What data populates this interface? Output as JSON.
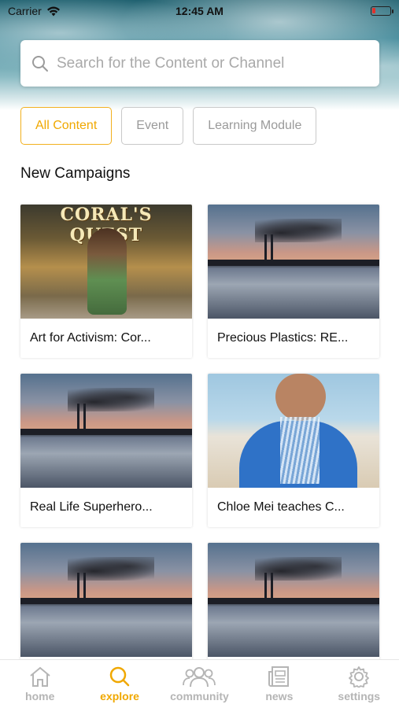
{
  "status_bar": {
    "carrier": "Carrier",
    "time": "12:45 AM"
  },
  "search": {
    "placeholder": "Search for the Content or Channel",
    "value": ""
  },
  "filters": [
    {
      "label": "All Content",
      "active": true
    },
    {
      "label": "Event",
      "active": false
    },
    {
      "label": "Learning Module",
      "active": false
    }
  ],
  "section": {
    "title": "New Campaigns"
  },
  "cards": [
    {
      "title": "Art for Activism: Cor...",
      "image": "comic-coral-quest",
      "image_text": "CORAL'S QUEST"
    },
    {
      "title": "Precious Plastics: RE...",
      "image": "sunset-factory"
    },
    {
      "title": "Real Life Superhero...",
      "image": "sunset-factory"
    },
    {
      "title": "Chloe Mei teaches C...",
      "image": "girl-with-straws"
    },
    {
      "title": "",
      "image": "sunset-factory"
    },
    {
      "title": "",
      "image": "sunset-factory"
    }
  ],
  "tabbar": [
    {
      "label": "home",
      "icon": "home-icon",
      "active": false
    },
    {
      "label": "explore",
      "icon": "search-icon",
      "active": true
    },
    {
      "label": "community",
      "icon": "people-icon",
      "active": false
    },
    {
      "label": "news",
      "icon": "newspaper-icon",
      "active": false
    },
    {
      "label": "settings",
      "icon": "gear-icon",
      "active": false
    }
  ],
  "colors": {
    "accent": "#f0a800",
    "inactive": "#b5b5b5"
  }
}
